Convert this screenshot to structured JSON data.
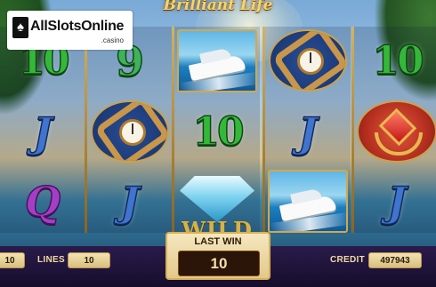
{
  "game": {
    "title": "Brilliant Life",
    "logo_text": "AllSlotsOnline",
    "logo_sub": ".casino",
    "logo_glyph": "♠"
  },
  "reels": [
    [
      {
        "type": "10",
        "label": "10"
      },
      {
        "type": "J",
        "label": "J"
      },
      {
        "type": "Q",
        "label": "Q"
      }
    ],
    [
      {
        "type": "9",
        "label": "9"
      },
      {
        "type": "watch",
        "label": ""
      },
      {
        "type": "J",
        "label": "J"
      }
    ],
    [
      {
        "type": "yacht",
        "label": ""
      },
      {
        "type": "10",
        "label": "10"
      },
      {
        "type": "wild",
        "label": "WILD"
      }
    ],
    [
      {
        "type": "watch",
        "label": ""
      },
      {
        "type": "J",
        "label": "J"
      },
      {
        "type": "yacht",
        "label": ""
      }
    ],
    [
      {
        "type": "10",
        "label": "10"
      },
      {
        "type": "ring",
        "label": ""
      },
      {
        "type": "J",
        "label": "J"
      }
    ]
  ],
  "bottom": {
    "bet_value": "10",
    "lines_label": "LINES",
    "lines_value": "10",
    "last_win_label": "LAST WIN",
    "last_win_value": "10",
    "credit_label": "CREDIT",
    "credit_value": "497943"
  },
  "colors": {
    "frame_gold": "#d4a84a",
    "ten_green": "#35b83a",
    "jack_blue": "#3f74cf",
    "queen_purple": "#a43fc5"
  }
}
